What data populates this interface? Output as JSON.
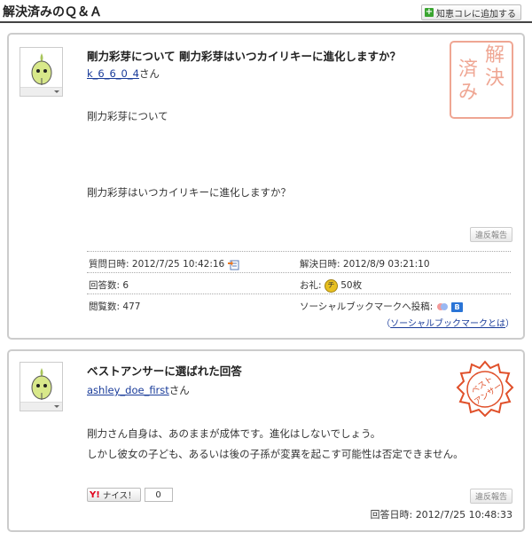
{
  "header": {
    "title": "解決済みのＱ＆Ａ",
    "add_button_label": "知恵コレに追加する"
  },
  "question": {
    "title": "剛力彩芽について 剛力彩芽はいつカイリキーに進化しますか？",
    "user_name": "k_6_6_0_4",
    "user_suffix": "さん",
    "body_line1": "剛力彩芽について",
    "body_line2": "剛力彩芽はいつカイリキーに進化しますか？",
    "violation_label": "違反報告",
    "stamp_text": "解決済み",
    "meta": {
      "asked_label": "質問日時:",
      "asked_value": "2012/7/25 10:42:16",
      "resolved_label": "解決日時:",
      "resolved_value": "2012/8/9 03:21:10",
      "answers_label": "回答数:",
      "answers_value": "6",
      "reward_label": "お礼:",
      "reward_value": "50枚",
      "views_label": "閲覧数:",
      "views_value": "477",
      "social_label": "ソーシャルブックマークへ投稿:",
      "social_link_open": "（",
      "social_link_text": "ソーシャルブックマークとは",
      "social_link_close": "）",
      "reward_icon_text": "チ",
      "hatena_icon_text": "B"
    }
  },
  "best_answer": {
    "heading": "ベストアンサーに選ばれた回答",
    "user_name": "ashley_doe_first",
    "user_suffix": "さん",
    "body_line1": "剛力さん自身は、あのままが成体です。進化はしないでしょう。",
    "body_line2": "しかし彼女の子ども、あるいは後の子孫が変異を起こす可能性は否定できません。",
    "violation_label": "違反報告",
    "nice_label": "ナイス！",
    "nice_logo": "Y!",
    "nice_count": "0",
    "answered_label": "回答日時:",
    "answered_value": "2012/7/25 10:48:33",
    "stamp_text_line1": "ベスト",
    "stamp_text_line2": "アンサー"
  },
  "colors": {
    "link": "#1a3c9a",
    "stamp_red": "#e0502a",
    "plus_green": "#3aa530"
  }
}
